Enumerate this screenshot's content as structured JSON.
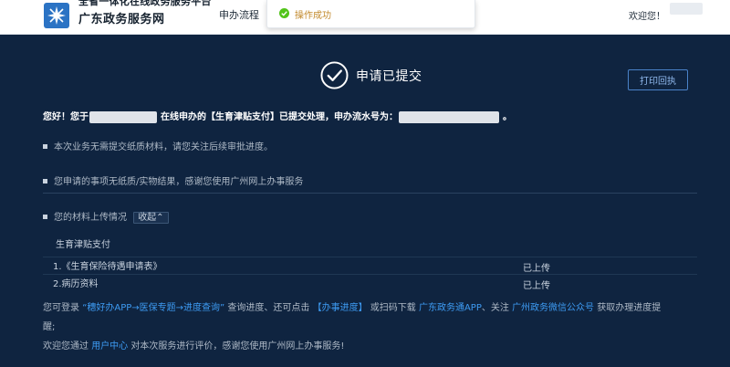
{
  "header": {
    "brand_top": "全省一体化在线政务服务平台",
    "brand_name": "广东政务服务网",
    "nav_item": "申办流程",
    "welcome": "欢迎您！"
  },
  "toast": {
    "message": "操作成功"
  },
  "status": {
    "title": "申请已提交",
    "print_button": "打印回执"
  },
  "summary": {
    "prefix": "您好！您于",
    "middle": "在线申办的【生育津贴支付】已提交处理，申办流水号为：",
    "suffix": "。"
  },
  "bullets": {
    "item1": "本次业务无需提交纸质材料，请您关注后续审批进度。",
    "item2": "您申请的事项无纸质/实物结果，感谢您使用广州网上办事服务",
    "item3": "您的材料上传情况",
    "collapse_label": "收起⌃"
  },
  "materials": {
    "section_title": "生育津贴支付",
    "rows": [
      {
        "name": "1.《生育保险待遇申请表》",
        "status": "已上传"
      },
      {
        "name": "2.病历资料",
        "status": "已上传"
      }
    ]
  },
  "notes": {
    "line1_a": "您可登录",
    "line1_link1": "“穗好办APP→医保专题→进度查询”",
    "line1_b": "查询进度、还可点击",
    "line1_link2": "【办事进度】",
    "line1_c": "或扫码下载",
    "line1_link3": "广东政务通APP",
    "line1_d": "、关注",
    "line1_link4": "广州政务微信公众号",
    "line1_e": "获取办理进度提",
    "line1_f": "醒;",
    "line2_a": "欢迎您通过",
    "line2_link": "用户中心",
    "line2_b": "对本次服务进行评价，感谢您使用广州网上办事服务!"
  },
  "colors": {
    "page_bg": "#0f2440",
    "accent_link": "#3d9bf3",
    "toast_text": "#c2892b",
    "success_green": "#52c41a"
  },
  "icons": {
    "logo": "gd-logo-icon",
    "toast": "success-check-icon",
    "status": "circle-check-icon"
  }
}
